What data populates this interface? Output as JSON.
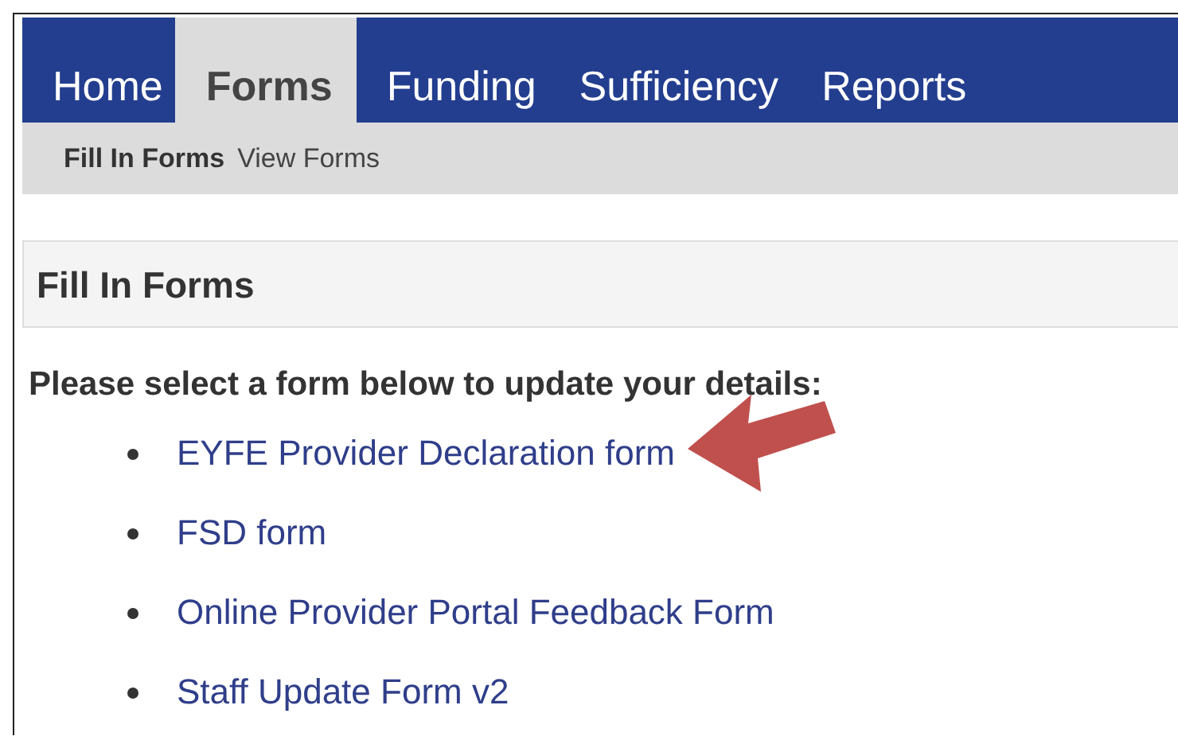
{
  "nav_tabs": [
    {
      "label": "Home",
      "selected": false
    },
    {
      "label": "Forms",
      "selected": true
    },
    {
      "label": "Funding",
      "selected": false
    },
    {
      "label": "Sufficiency",
      "selected": false
    },
    {
      "label": "Reports",
      "selected": false
    }
  ],
  "sub_nav": [
    {
      "label": "Fill In Forms",
      "selected": true
    },
    {
      "label": "View Forms",
      "selected": false
    }
  ],
  "section_title": "Fill In Forms",
  "instruction": "Please select a form below to update your details:",
  "forms": [
    {
      "label": "EYFE Provider Declaration form",
      "pointed_at": true
    },
    {
      "label": "FSD form",
      "pointed_at": false
    },
    {
      "label": "Online Provider Portal Feedback Form",
      "pointed_at": false
    },
    {
      "label": "Staff Update Form v2",
      "pointed_at": false
    }
  ]
}
